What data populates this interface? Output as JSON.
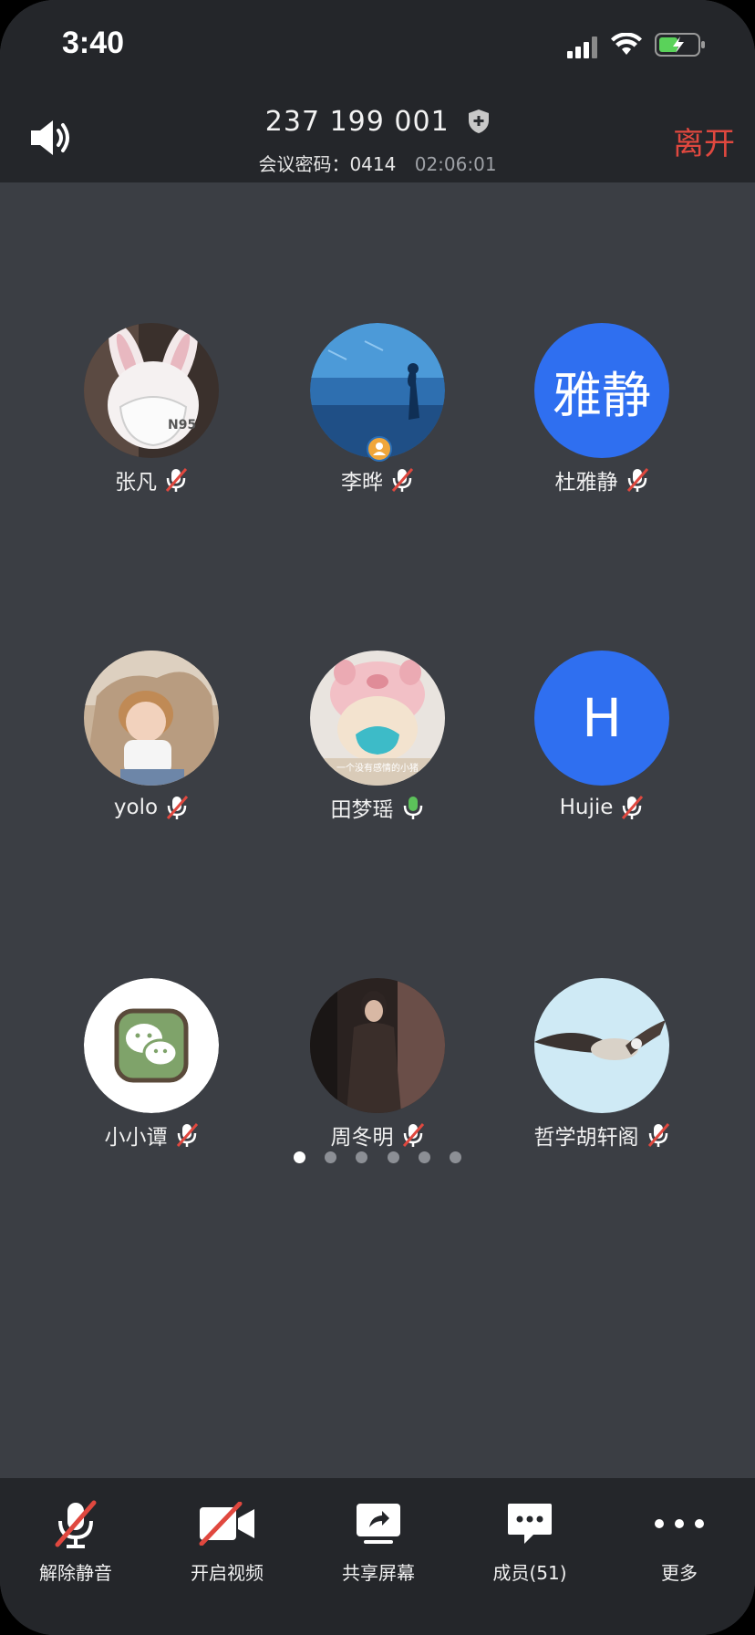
{
  "status": {
    "time": "3:40"
  },
  "header": {
    "meeting_id": "237 199 001",
    "password_label": "会议密码：",
    "password": "0414",
    "elapsed": "02:06:01",
    "leave_label": "离开"
  },
  "participants": [
    {
      "name": "张凡",
      "mic": "muted",
      "avatar": "photo-rabbit-mask"
    },
    {
      "name": "李晔",
      "mic": "muted",
      "avatar": "photo-aquarium",
      "host": true
    },
    {
      "name": "杜雅静",
      "mic": "muted",
      "avatar_text": "雅静"
    },
    {
      "name": "yolo",
      "mic": "muted",
      "avatar": "photo-child"
    },
    {
      "name": "田梦瑶",
      "mic": "speaking",
      "avatar": "photo-cat-pig-hat",
      "avatar_caption": "一个没有感情的小猪"
    },
    {
      "name": "Hujie",
      "mic": "muted",
      "avatar_text": "H"
    },
    {
      "name": "小小谭",
      "mic": "muted",
      "avatar": "wechat-logo"
    },
    {
      "name": "周冬明",
      "mic": "muted",
      "avatar": "photo-person-dark"
    },
    {
      "name": "哲学胡轩阁",
      "mic": "muted",
      "avatar": "photo-bird"
    }
  ],
  "pagination": {
    "pages": 6,
    "current": 1
  },
  "toolbar": {
    "unmute_label": "解除静音",
    "video_label": "开启视频",
    "share_label": "共享屏幕",
    "members_label": "成员(51)",
    "more_label": "更多"
  },
  "colors": {
    "background": "#3b3e44",
    "bar": "#24262a",
    "leave": "#e0483f",
    "avatar_blue": "#2f6ff0",
    "speaking_mic": "#5cc15a"
  }
}
